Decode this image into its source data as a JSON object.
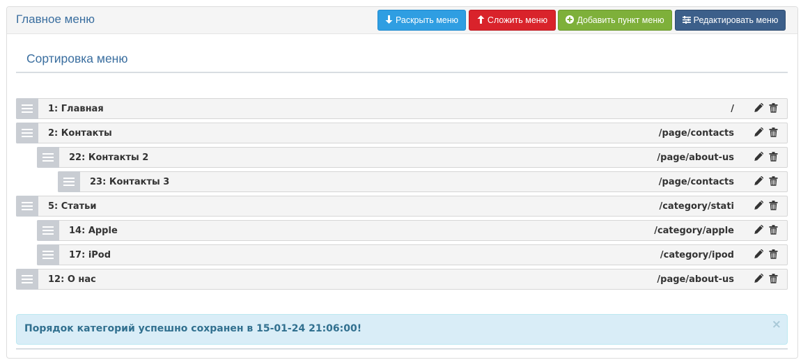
{
  "panel": {
    "title": "Главное меню"
  },
  "toolbar": {
    "expand_label": "Раскрыть меню",
    "collapse_label": "Сложить меню",
    "add_label": "Добавить пункт меню",
    "edit_label": "Редактировать меню"
  },
  "section": {
    "title": "Сортировка меню"
  },
  "menu_items": [
    {
      "label": "1: Главная",
      "url": "/",
      "level": 0
    },
    {
      "label": "2: Контакты",
      "url": "/page/contacts",
      "level": 0
    },
    {
      "label": "22: Контакты 2",
      "url": "/page/about-us",
      "level": 1
    },
    {
      "label": "23: Контакты 3",
      "url": "/page/contacts",
      "level": 2
    },
    {
      "label": "5: Статьи",
      "url": "/category/stati",
      "level": 0
    },
    {
      "label": "14: Apple",
      "url": "/category/apple",
      "level": 1
    },
    {
      "label": "17: iPod",
      "url": "/category/ipod",
      "level": 1
    },
    {
      "label": "12: О нас",
      "url": "/page/about-us",
      "level": 0
    }
  ],
  "alert": {
    "message": "Порядок категорий успешно сохранен в 15-01-24 21:06:00!",
    "close": "×"
  },
  "colors": {
    "expand": "#2f9ee2",
    "collapse": "#d9232b",
    "add": "#7eb03a",
    "edit": "#3c5f8a",
    "title": "#3a6e9f"
  }
}
